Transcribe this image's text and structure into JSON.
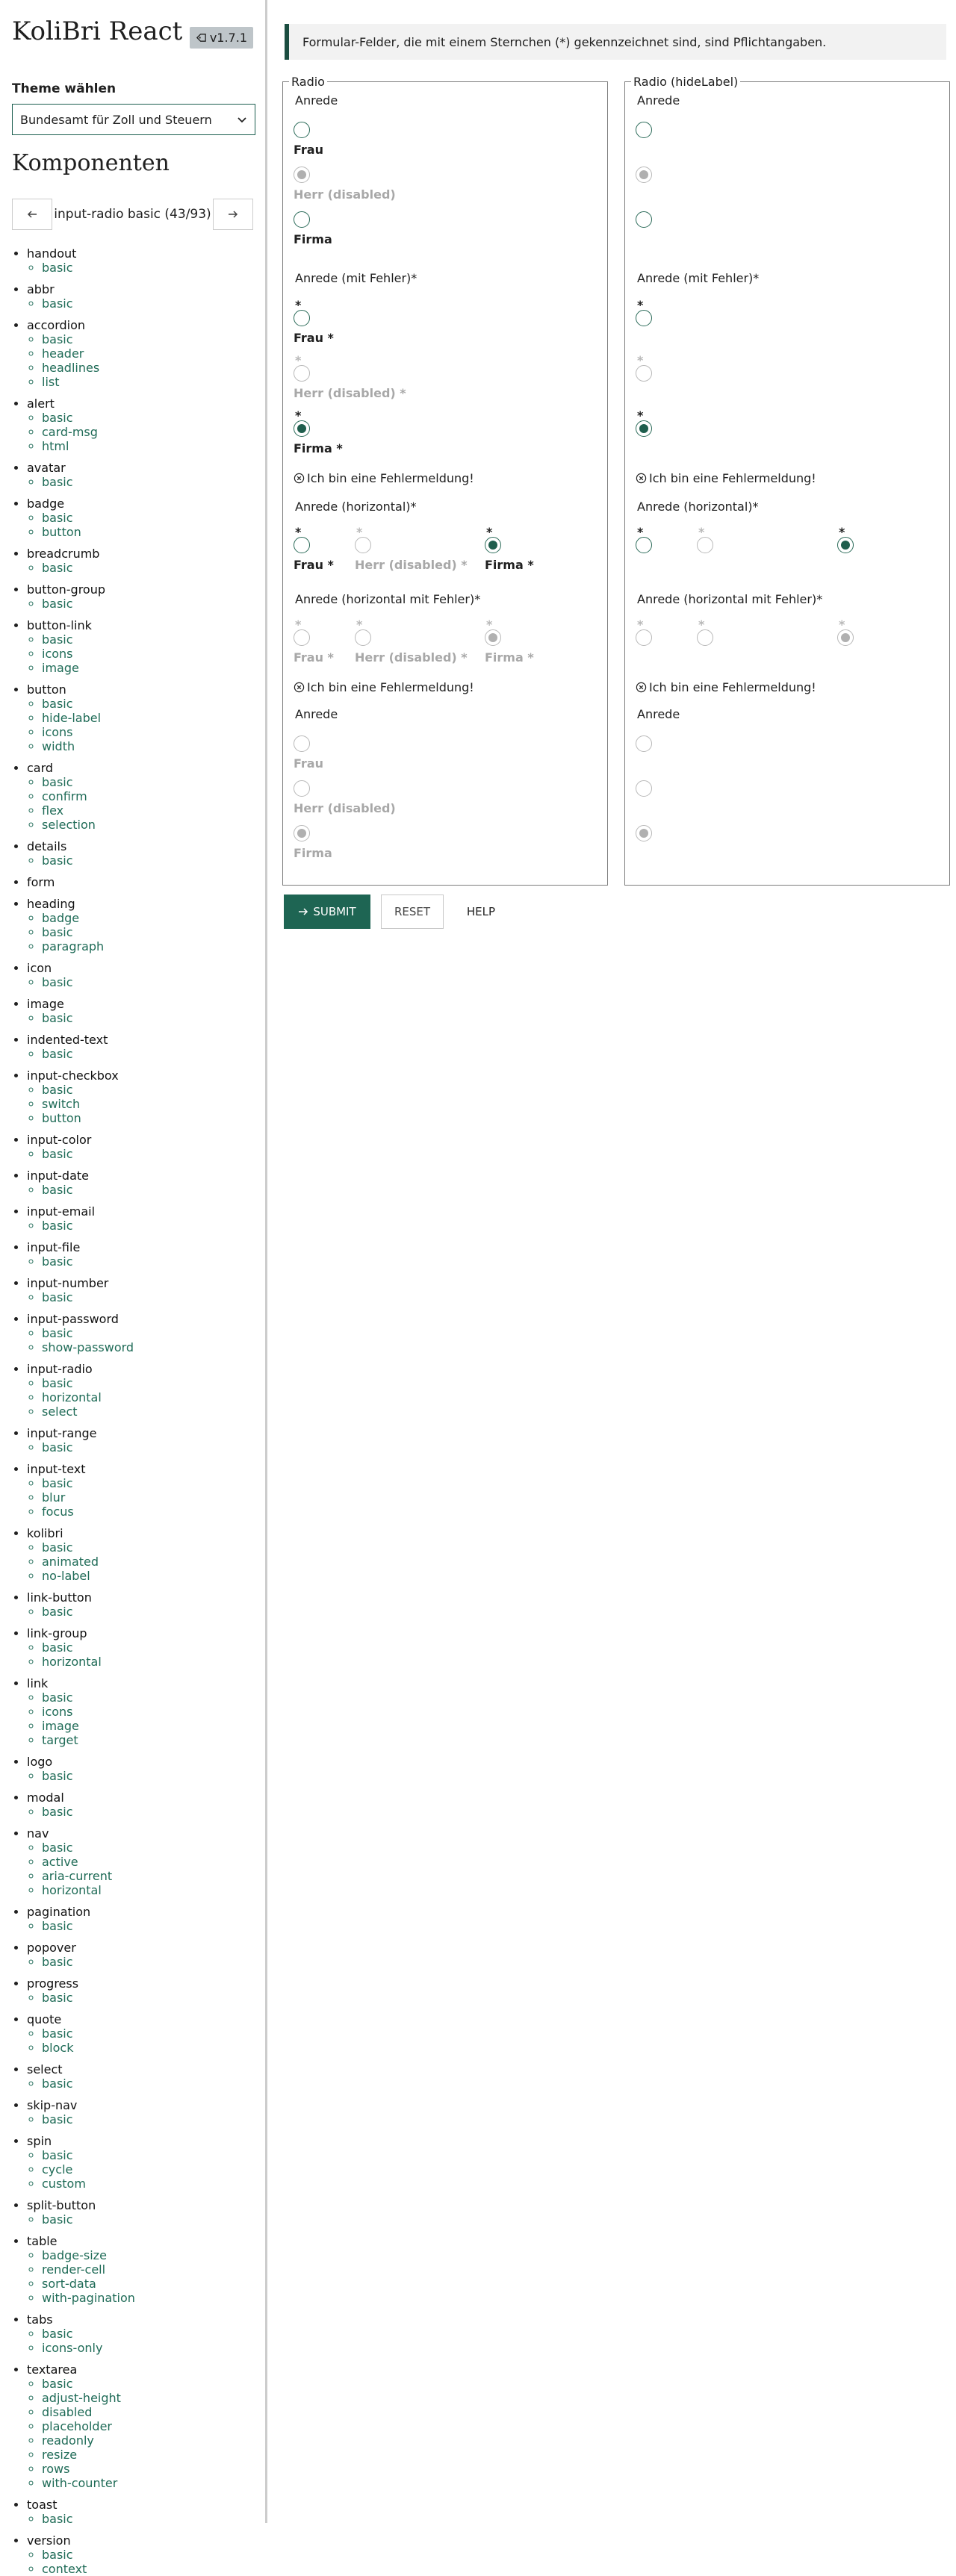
{
  "app": {
    "title": "KoliBri React",
    "version": "v1.7.1"
  },
  "theme": {
    "label": "Theme wählen",
    "selected": "Bundesamt für Zoll und Steuern"
  },
  "components": {
    "title": "Komponenten",
    "pager_text": "input-radio basic (43/93)"
  },
  "nav": [
    {
      "name": "handout",
      "items": [
        "basic"
      ]
    },
    {
      "name": "abbr",
      "items": [
        "basic"
      ]
    },
    {
      "name": "accordion",
      "items": [
        "basic",
        "header",
        "headlines",
        "list"
      ]
    },
    {
      "name": "alert",
      "items": [
        "basic",
        "card-msg",
        "html"
      ]
    },
    {
      "name": "avatar",
      "items": [
        "basic"
      ]
    },
    {
      "name": "badge",
      "items": [
        "basic",
        "button"
      ]
    },
    {
      "name": "breadcrumb",
      "items": [
        "basic"
      ]
    },
    {
      "name": "button-group",
      "items": [
        "basic"
      ]
    },
    {
      "name": "button-link",
      "items": [
        "basic",
        "icons",
        "image"
      ]
    },
    {
      "name": "button",
      "items": [
        "basic",
        "hide-label",
        "icons",
        "width"
      ]
    },
    {
      "name": "card",
      "items": [
        "basic",
        "confirm",
        "flex",
        "selection"
      ]
    },
    {
      "name": "details",
      "items": [
        "basic"
      ]
    },
    {
      "name": "form",
      "items": []
    },
    {
      "name": "heading",
      "items": [
        "badge",
        "basic",
        "paragraph"
      ]
    },
    {
      "name": "icon",
      "items": [
        "basic"
      ]
    },
    {
      "name": "image",
      "items": [
        "basic"
      ]
    },
    {
      "name": "indented-text",
      "items": [
        "basic"
      ]
    },
    {
      "name": "input-checkbox",
      "items": [
        "basic",
        "switch",
        "button"
      ]
    },
    {
      "name": "input-color",
      "items": [
        "basic"
      ]
    },
    {
      "name": "input-date",
      "items": [
        "basic"
      ]
    },
    {
      "name": "input-email",
      "items": [
        "basic"
      ]
    },
    {
      "name": "input-file",
      "items": [
        "basic"
      ]
    },
    {
      "name": "input-number",
      "items": [
        "basic"
      ]
    },
    {
      "name": "input-password",
      "items": [
        "basic",
        "show-password"
      ]
    },
    {
      "name": "input-radio",
      "items": [
        "basic",
        "horizontal",
        "select"
      ]
    },
    {
      "name": "input-range",
      "items": [
        "basic"
      ]
    },
    {
      "name": "input-text",
      "items": [
        "basic",
        "blur",
        "focus"
      ]
    },
    {
      "name": "kolibri",
      "items": [
        "basic",
        "animated",
        "no-label"
      ]
    },
    {
      "name": "link-button",
      "items": [
        "basic"
      ]
    },
    {
      "name": "link-group",
      "items": [
        "basic",
        "horizontal"
      ]
    },
    {
      "name": "link",
      "items": [
        "basic",
        "icons",
        "image",
        "target"
      ]
    },
    {
      "name": "logo",
      "items": [
        "basic"
      ]
    },
    {
      "name": "modal",
      "items": [
        "basic"
      ]
    },
    {
      "name": "nav",
      "items": [
        "basic",
        "active",
        "aria-current",
        "horizontal"
      ]
    },
    {
      "name": "pagination",
      "items": [
        "basic"
      ]
    },
    {
      "name": "popover",
      "items": [
        "basic"
      ]
    },
    {
      "name": "progress",
      "items": [
        "basic"
      ]
    },
    {
      "name": "quote",
      "items": [
        "basic",
        "block"
      ]
    },
    {
      "name": "select",
      "items": [
        "basic"
      ]
    },
    {
      "name": "skip-nav",
      "items": [
        "basic"
      ]
    },
    {
      "name": "spin",
      "items": [
        "basic",
        "cycle",
        "custom"
      ]
    },
    {
      "name": "split-button",
      "items": [
        "basic"
      ]
    },
    {
      "name": "table",
      "items": [
        "badge-size",
        "render-cell",
        "sort-data",
        "with-pagination"
      ]
    },
    {
      "name": "tabs",
      "items": [
        "basic",
        "icons-only"
      ]
    },
    {
      "name": "textarea",
      "items": [
        "basic",
        "adjust-height",
        "disabled",
        "placeholder",
        "readonly",
        "resize",
        "rows",
        "with-counter"
      ]
    },
    {
      "name": "toast",
      "items": [
        "basic"
      ]
    },
    {
      "name": "version",
      "items": [
        "basic",
        "context"
      ]
    }
  ],
  "form": {
    "required_note": "Formular-Felder, die mit einem Sternchen (*) gekennzeichnet sind, sind Pflichtangaben.",
    "left_legend": "Radio",
    "right_legend": "Radio (hideLabel)",
    "group_anrede": "Anrede",
    "group_anrede_error": "Anrede (mit Fehler)*",
    "group_horizontal": "Anrede (horizontal)*",
    "group_horizontal_error": "Anrede (horizontal mit Fehler)*",
    "group_anrede_disabled": "Anrede",
    "opt_frau": "Frau",
    "opt_herr_disabled": "Herr (disabled)",
    "opt_firma": "Firma",
    "opt_frau_req": "Frau *",
    "opt_herr_disabled_req": "Herr (disabled) *",
    "opt_firma_req": "Firma *",
    "star": "*",
    "error_text": "Ich bin eine Fehlermeldung!",
    "submit": "SUBMIT",
    "reset": "RESET",
    "help": "HELP"
  }
}
